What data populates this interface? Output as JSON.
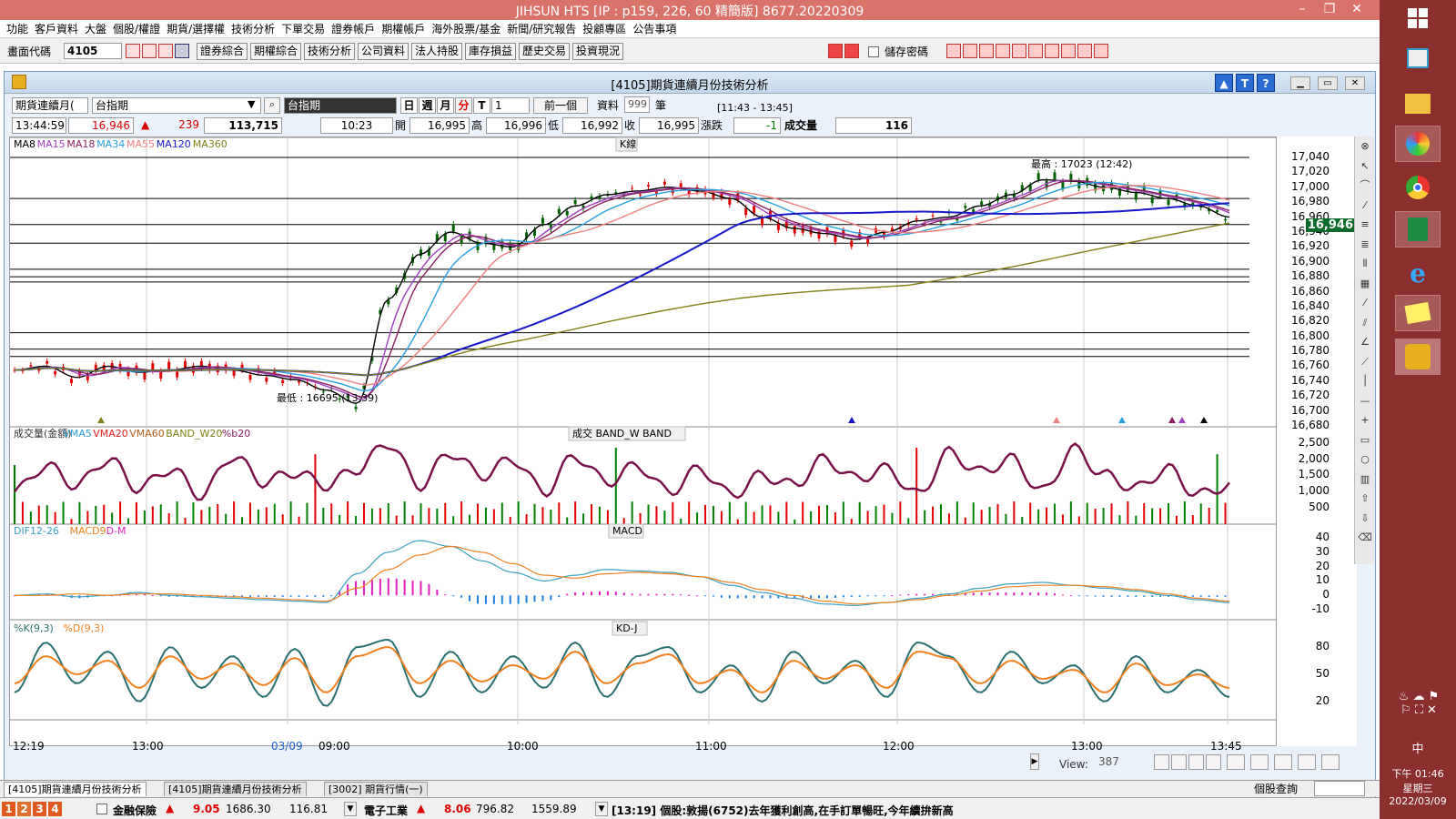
{
  "app": {
    "title": "JIHSUN HTS    [IP : p159, 226, 60 精簡版] 8677.20220309"
  },
  "menu": [
    "功能",
    "客戶資料",
    "大盤",
    "個股/權證",
    "期貨/選擇權",
    "技術分析",
    "下單交易",
    "證券帳戶",
    "期權帳戶",
    "海外股票/基金",
    "新聞/研究報告",
    "投顧專區",
    "公告事項"
  ],
  "toolbar": {
    "code_label": "畫面代碼",
    "code_value": "4105",
    "buttons": [
      "證券綜合",
      "期權綜合",
      "技術分析",
      "公司資料",
      "法人持股",
      "庫存損益",
      "歷史交易",
      "投資現況"
    ],
    "save_pwd": "儲存密碼"
  },
  "window": {
    "title": "[4105]期貨連續月份技術分析"
  },
  "controls": {
    "series_select": "期貨連續月(",
    "symbol": "台指期",
    "symbol_display": "台指期",
    "periods": [
      "日",
      "週",
      "月",
      "分",
      "T"
    ],
    "active_period": "分",
    "interval": "1",
    "prev_btn": "前一個",
    "data_label": "資料",
    "data_count": "999",
    "unit": "筆",
    "time_range": "[11:43 - 13:45]"
  },
  "quote": {
    "time": "13:44:59",
    "price": "16,946",
    "change": "239",
    "volume_total": "113,715",
    "bar_time": "10:23",
    "open_label": "開",
    "open": "16,995",
    "high_label": "高",
    "high": "16,996",
    "low_label": "低",
    "low": "16,992",
    "close_label": "收",
    "close": "16,995",
    "chg_label": "漲跌",
    "chg": "-1",
    "vol_label": "成交量",
    "vol": "116"
  },
  "panels": {
    "kline": {
      "legend": [
        "MA8",
        "MA15",
        "MA18",
        "MA34",
        "MA55",
        "MA120",
        "MA360"
      ],
      "legend_colors": [
        "#000000",
        "#a040c0",
        "#8a2060",
        "#2aa0e0",
        "#f08080",
        "#1818c8",
        "#808018"
      ],
      "name": "K線",
      "max_label": "最高 : 17023 (12:42)",
      "min_label": "最低 : 16695 (13:39)",
      "last_price": "16,946",
      "y_ticks": [
        "17,040",
        "17,020",
        "17,000",
        "16,980",
        "16,960",
        "16,940",
        "16,920",
        "16,900",
        "16,880",
        "16,860",
        "16,840",
        "16,820",
        "16,800",
        "16,780",
        "16,760",
        "16,740",
        "16,720",
        "16,700",
        "16,680"
      ]
    },
    "volume": {
      "legend": [
        "成交量(金額)",
        "VMA5",
        "VMA20",
        "VMA60",
        "BAND_W20",
        "%b20"
      ],
      "legend_colors": [
        "#333333",
        "#2aa0e0",
        "#e02020",
        "#b06020",
        "#808018",
        "#8a2060"
      ],
      "name": "成交  BAND_W  BAND",
      "y_ticks": [
        "2,500",
        "2,000",
        "1,500",
        "1,000",
        "500"
      ]
    },
    "macd": {
      "legend": [
        "DIF12-26",
        "MACD9",
        "D-M"
      ],
      "legend_colors": [
        "#3aa0c0",
        "#f08020",
        "#e020c0"
      ],
      "name": "MACD",
      "y_ticks": [
        "40",
        "30",
        "20",
        "10",
        "0",
        "-10"
      ]
    },
    "kd": {
      "legend": [
        "%K(9,3)",
        "%D(9,3)"
      ],
      "legend_colors": [
        "#2a7070",
        "#f08020"
      ],
      "name": "KD-J",
      "y_ticks": [
        "80",
        "50",
        "20"
      ]
    }
  },
  "x_axis": [
    {
      "label": "12:19"
    },
    {
      "label": "13:00"
    },
    {
      "label": "03/09",
      "color": "#2060d0"
    },
    {
      "label": "09:00"
    },
    {
      "label": "10:00"
    },
    {
      "label": "11:00"
    },
    {
      "label": "12:00"
    },
    {
      "label": "13:00"
    },
    {
      "label": "13:45"
    }
  ],
  "view": {
    "label": "View:",
    "value": "387"
  },
  "tabs": [
    "[4105]期貨連續月份技術分析",
    "[4105]期貨連續月份技術分析",
    "[3002] 期貨行情(一)"
  ],
  "right_search": "個股查詢",
  "statusbar": {
    "nums": [
      "1",
      "2",
      "3",
      "4"
    ],
    "sector1": "金融保險",
    "s1_chg": "9.05",
    "s1_idx": "1686.30",
    "s1_vol": "116.81",
    "sector2": "電子工業",
    "s2_chg": "8.06",
    "s2_idx": "796.82",
    "s2_vol": "1559.89",
    "news": "[13:19] 個股:敦揚(6752)去年獲利創高,在手訂單暢旺,今年續拚新高"
  },
  "taskbar": {
    "time": "下午 01:46",
    "weekday": "星期三",
    "date": "2022/03/09",
    "ime": "中"
  },
  "chart_data": [
    {
      "type": "candlestick",
      "title": "K線",
      "x_range": [
        "12:19",
        "13:45"
      ],
      "ylim": [
        16680,
        17040
      ],
      "max": {
        "value": 17023,
        "time": "12:42"
      },
      "min": {
        "value": 16695,
        "time": "13:39"
      },
      "last": 16946,
      "ma8": [
        16755,
        16760,
        16745,
        16760,
        16752,
        16755,
        16760,
        16755,
        16748,
        16742,
        16728,
        16710,
        16850,
        16910,
        16940,
        16925,
        16920,
        16950,
        16975,
        16990,
        16995,
        17000,
        16995,
        16985,
        16960,
        16945,
        16938,
        16930,
        16940,
        16955,
        16960,
        16975,
        16990,
        17010,
        17008,
        17000,
        16993,
        16985,
        16975,
        16960
      ]
    },
    {
      "type": "line",
      "title": "成交量(金額)",
      "ylim": [
        0,
        2800
      ],
      "series": [
        {
          "name": "%b20",
          "values": [
            1000,
            1800,
            1200,
            2000,
            1100,
            1700,
            900,
            2100,
            1300,
            1600,
            1200,
            1700,
            2500,
            1200,
            2200,
            1500,
            2000,
            1000,
            2100,
            1300,
            1800,
            1000,
            1700,
            900,
            1500,
            1200,
            2000,
            1400,
            1700,
            900,
            2200,
            1600,
            2000,
            1000,
            2300,
            1500,
            1100,
            1700,
            900,
            1200
          ]
        }
      ]
    },
    {
      "type": "line",
      "title": "MACD",
      "ylim": [
        -15,
        45
      ],
      "series": [
        {
          "name": "DIF12-26",
          "values": [
            0,
            1,
            -1,
            0,
            2,
            0,
            -1,
            -2,
            -3,
            -4,
            -5,
            15,
            30,
            38,
            34,
            24,
            16,
            10,
            14,
            18,
            17,
            16,
            13,
            7,
            2,
            -2,
            -6,
            -7,
            -5,
            -2,
            1,
            5,
            8,
            9,
            7,
            5,
            3,
            0,
            -3,
            -5
          ]
        },
        {
          "name": "MACD9",
          "values": [
            0,
            0,
            1,
            0,
            1,
            1,
            0,
            -1,
            -2,
            -3,
            -4,
            5,
            18,
            28,
            34,
            30,
            22,
            14,
            12,
            15,
            16,
            15,
            13,
            9,
            4,
            0,
            -4,
            -6,
            -5,
            -3,
            0,
            3,
            6,
            7,
            7,
            6,
            4,
            1,
            -2,
            -4
          ]
        }
      ]
    },
    {
      "type": "line",
      "title": "KD-J",
      "ylim": [
        0,
        100
      ],
      "series": [
        {
          "name": "%K(9,3)",
          "values": [
            30,
            85,
            40,
            75,
            20,
            80,
            35,
            70,
            25,
            78,
            15,
            80,
            88,
            25,
            75,
            30,
            70,
            35,
            85,
            25,
            70,
            80,
            30,
            60,
            20,
            75,
            40,
            65,
            25,
            85,
            70,
            30,
            75,
            40,
            60,
            20,
            70,
            30,
            55,
            25
          ]
        },
        {
          "name": "%D(9,3)",
          "values": [
            40,
            70,
            50,
            65,
            35,
            70,
            45,
            62,
            38,
            68,
            30,
            70,
            80,
            40,
            65,
            42,
            60,
            45,
            75,
            40,
            62,
            72,
            40,
            55,
            30,
            65,
            45,
            60,
            35,
            75,
            68,
            40,
            65,
            45,
            55,
            30,
            62,
            38,
            50,
            35
          ]
        }
      ]
    }
  ]
}
